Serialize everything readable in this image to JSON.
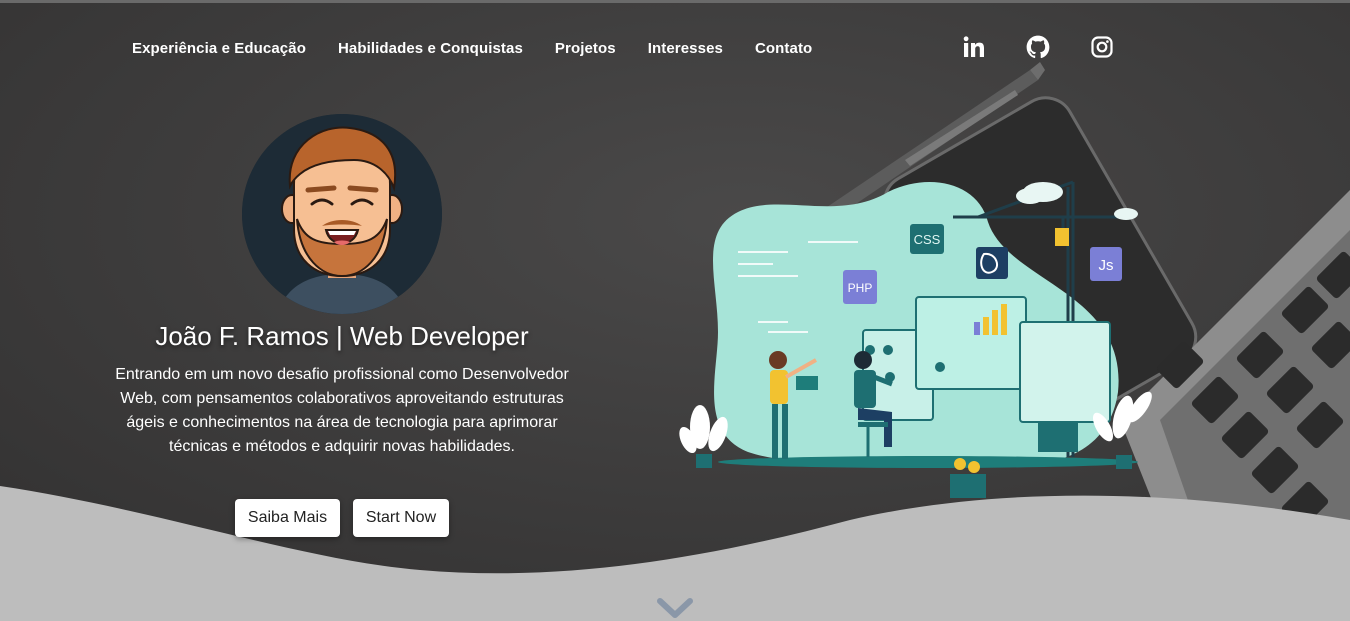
{
  "nav": {
    "items": [
      {
        "label": "Experiência e Educação"
      },
      {
        "label": "Habilidades e Conquistas"
      },
      {
        "label": "Projetos"
      },
      {
        "label": "Interesses"
      },
      {
        "label": "Contato"
      }
    ]
  },
  "social": {
    "icons": [
      "linkedin-icon",
      "github-icon",
      "instagram-icon"
    ]
  },
  "hero": {
    "title": "João F. Ramos | Web Developer",
    "description": "Entrando em um novo desafio profissional como Desenvolvedor Web, com pensamentos colaborativos aproveitando estruturas ágeis e conhecimentos na área de tecnologia para aprimorar técnicas e métodos e adquirir novas habilidades.",
    "primary_button": "Saiba Mais",
    "secondary_button": "Start Now"
  },
  "illustration": {
    "badges": {
      "css": "CSS",
      "php": "PHP",
      "js": "Js"
    }
  },
  "colors": {
    "background": "#3a3939",
    "wave": "#bdbdbd",
    "teal": "#9fe3d6",
    "accent_teal": "#1e7d7a",
    "chevron": "#8a97a8"
  }
}
